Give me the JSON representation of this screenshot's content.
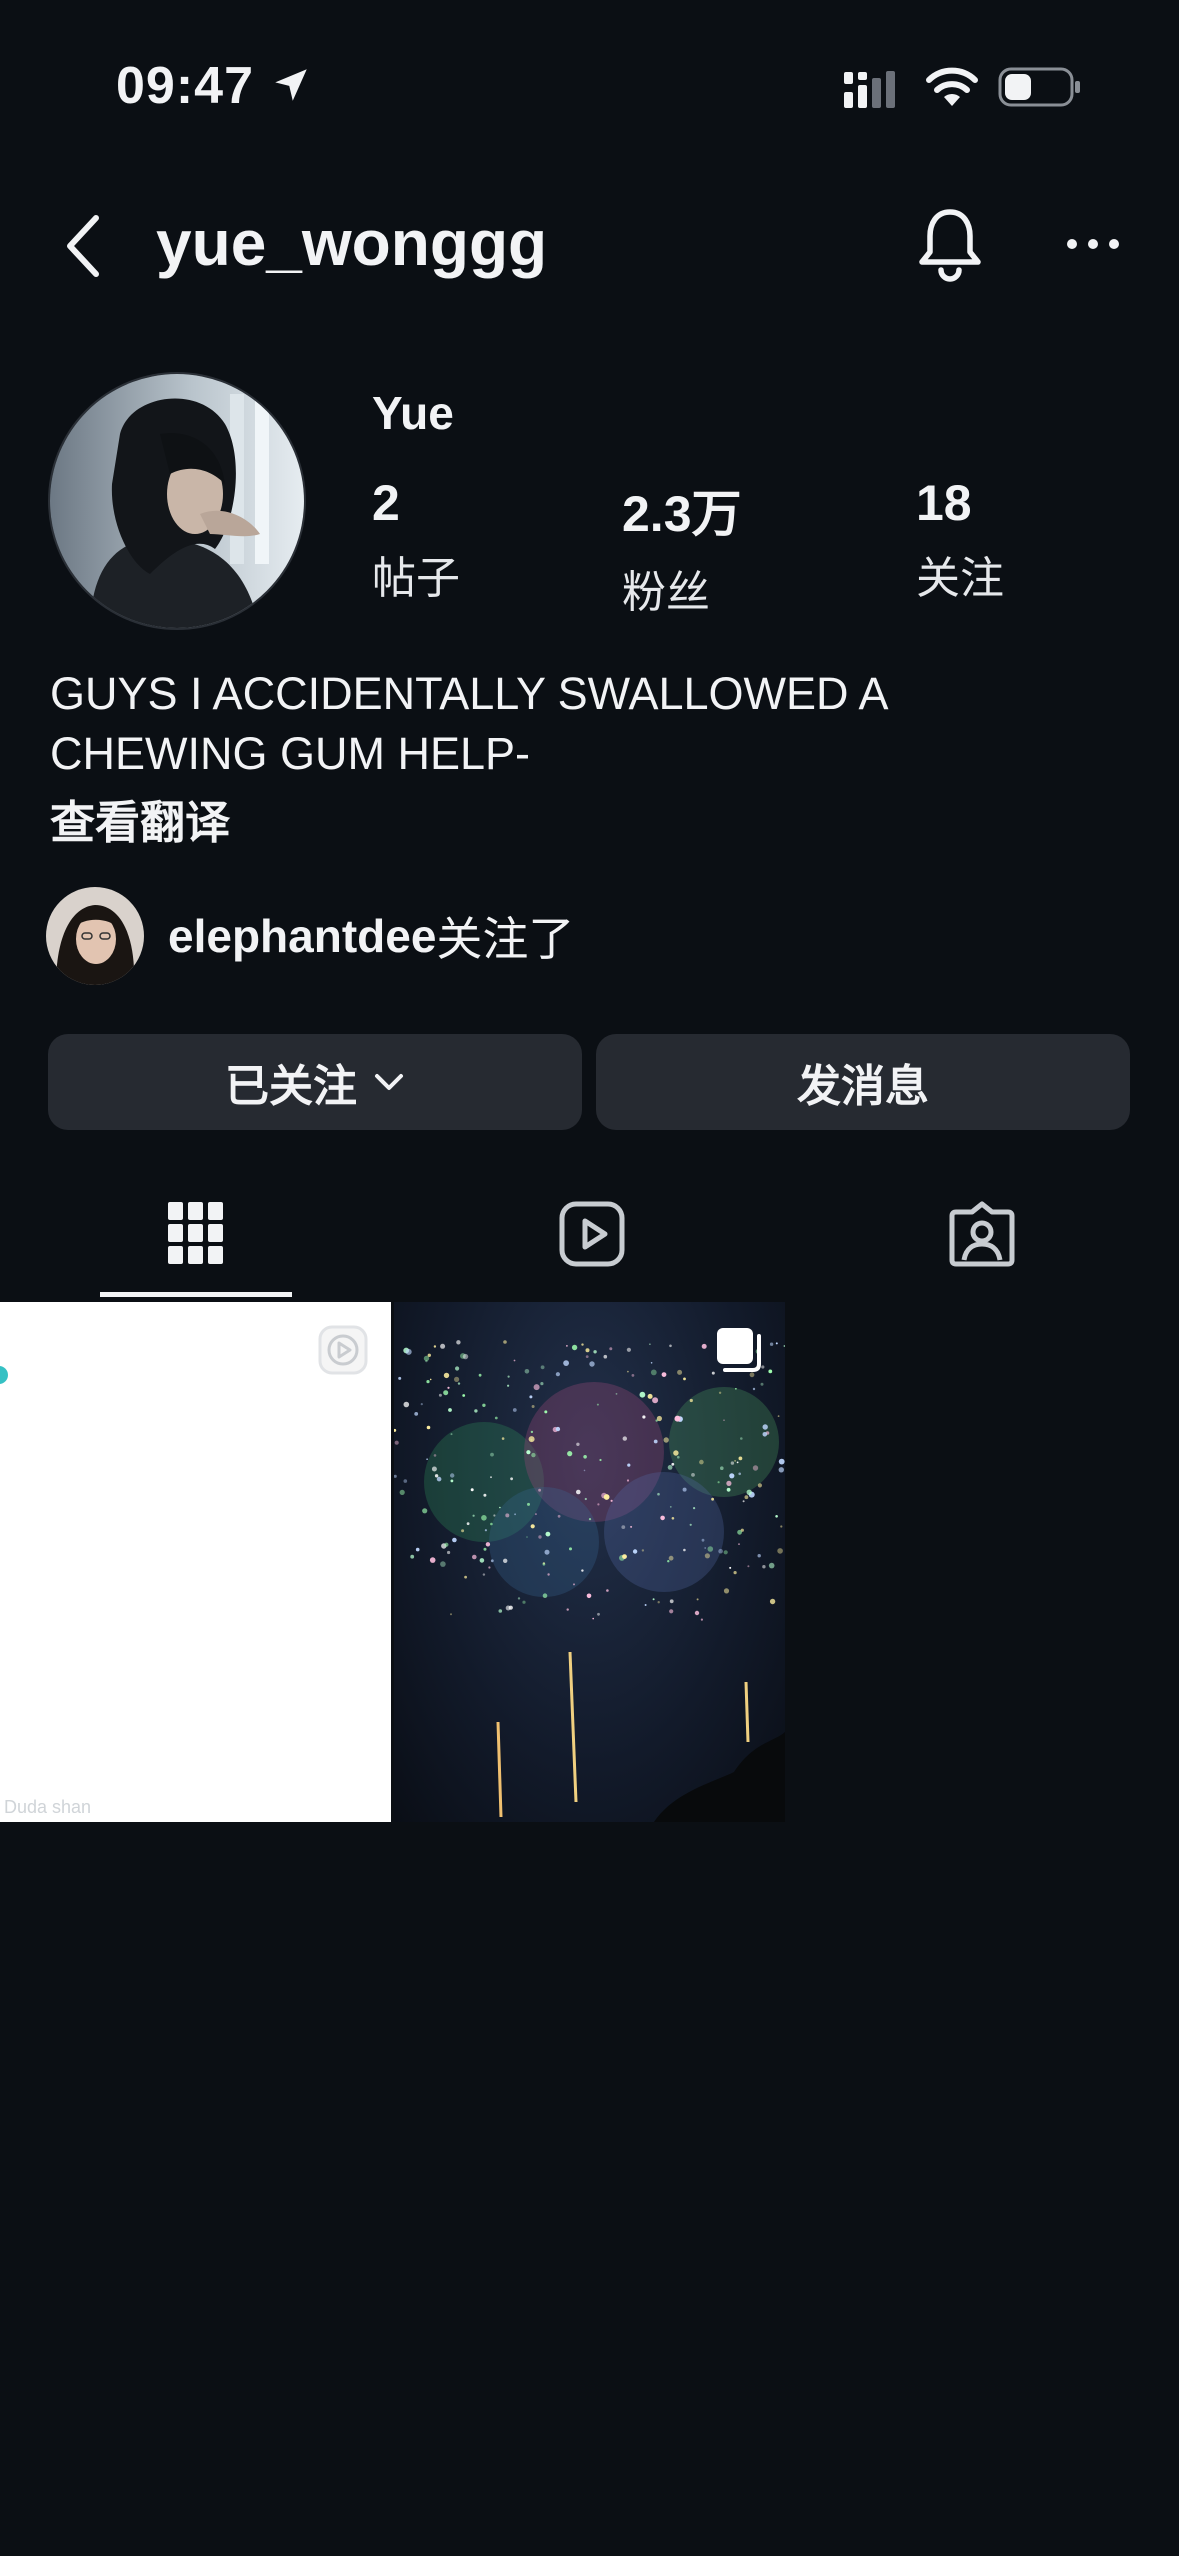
{
  "status_bar": {
    "time": "09:47",
    "icons": [
      "location-arrow-icon",
      "cellular-signal-icon",
      "wifi-icon",
      "battery-icon"
    ]
  },
  "header": {
    "username": "yue_wonggg",
    "icons": [
      "chevron-left-icon",
      "bell-icon",
      "more-dots-icon"
    ]
  },
  "profile": {
    "display_name": "Yue",
    "stats": [
      {
        "value": "2",
        "label": "帖子"
      },
      {
        "value": "2.3万",
        "label": "粉丝"
      },
      {
        "value": "18",
        "label": "关注"
      }
    ],
    "bio_line1": "GUYS I ACCIDENTALLY SWALLOWED A",
    "bio_line2": "CHEWING GUM HELP-",
    "see_translation": "查看翻译",
    "mutual": {
      "name": "elephantdee",
      "suffix": "关注了"
    }
  },
  "buttons": {
    "following": "已关注",
    "message": "发消息"
  },
  "tabs": [
    {
      "icon": "grid-icon",
      "active": true
    },
    {
      "icon": "reels-icon",
      "active": false
    },
    {
      "icon": "tagged-icon",
      "active": false
    }
  ],
  "posts": [
    {
      "type": "reel",
      "badge": "reel-play-icon",
      "watermark": "Duda shan"
    },
    {
      "type": "carousel",
      "badge": "carousel-icon",
      "subject": "fireworks"
    }
  ],
  "colors": {
    "background": "#0b0f14",
    "button": "#262a31",
    "text": "#f2f3f5"
  }
}
